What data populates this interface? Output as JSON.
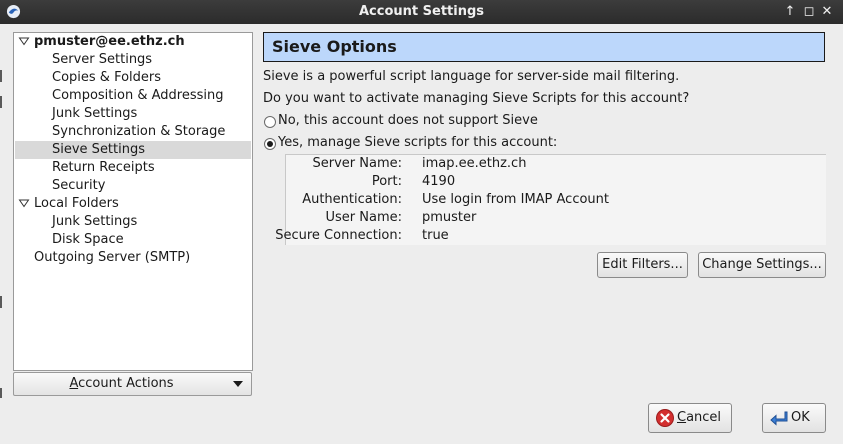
{
  "window": {
    "title": "Account Settings",
    "controls": {
      "pin": "↑",
      "maximize": "◻",
      "close": "✕"
    }
  },
  "tree": {
    "items": [
      {
        "label": "pmuster@ee.ethz.ch",
        "level": 0,
        "expanded": true,
        "bold": true
      },
      {
        "label": "Server Settings",
        "level": 1
      },
      {
        "label": "Copies & Folders",
        "level": 1
      },
      {
        "label": "Composition & Addressing",
        "level": 1
      },
      {
        "label": "Junk Settings",
        "level": 1
      },
      {
        "label": "Synchronization & Storage",
        "level": 1
      },
      {
        "label": "Sieve Settings",
        "level": 1,
        "selected": true
      },
      {
        "label": "Return Receipts",
        "level": 1
      },
      {
        "label": "Security",
        "level": 1
      },
      {
        "label": "Local Folders",
        "level": 0,
        "expanded": true
      },
      {
        "label": "Junk Settings",
        "level": 1
      },
      {
        "label": "Disk Space",
        "level": 1
      },
      {
        "label": "Outgoing Server (SMTP)",
        "level": 0
      }
    ],
    "account_actions": {
      "label_prefix": "",
      "label_accel": "A",
      "label_rest": "ccount Actions"
    }
  },
  "sieve": {
    "title": "Sieve Options",
    "intro": "Sieve is a powerful script language for server-side mail filtering.",
    "question": "Do you want to activate managing Sieve Scripts for this account?",
    "option_no": "No, this account does not support Sieve",
    "option_yes": "Yes, manage Sieve scripts for this account:",
    "selected": "yes",
    "details": [
      {
        "key": "Server Name:",
        "value": "imap.ee.ethz.ch"
      },
      {
        "key": "Port:",
        "value": "4190"
      },
      {
        "key": "Authentication:",
        "value": "Use login from IMAP Account"
      },
      {
        "key": "User Name:",
        "value": "pmuster"
      },
      {
        "key": "Secure Connection:",
        "value": "true"
      }
    ],
    "edit_filters": "Edit Filters...",
    "change_settings": "Change Settings..."
  },
  "footer": {
    "cancel_accel": "C",
    "cancel_rest": "ancel",
    "ok": "OK"
  },
  "colors": {
    "title_bg": "#bcd7fb",
    "selected_row": "#d9d9d9",
    "titlebar": "#2b2b2b",
    "cancel_icon": "#d32f2f"
  }
}
